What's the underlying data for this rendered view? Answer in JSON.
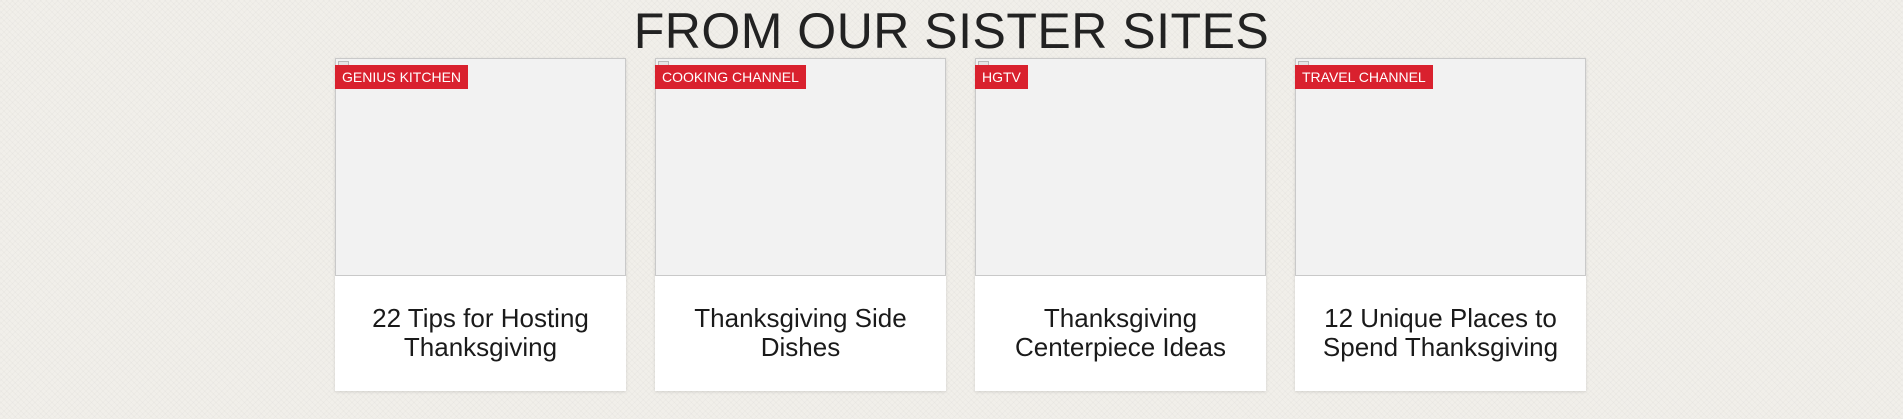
{
  "section": {
    "title": "FROM OUR SISTER SITES"
  },
  "cards": [
    {
      "source": "GENIUS KITCHEN",
      "title": "22 Tips for Hosting Thanksgiving"
    },
    {
      "source": "COOKING CHANNEL",
      "title": "Thanksgiving Side Dishes"
    },
    {
      "source": "HGTV",
      "title": "Thanksgiving Centerpiece Ideas"
    },
    {
      "source": "TRAVEL CHANNEL",
      "title": "12 Unique Places to Spend Thanksgiving"
    }
  ],
  "colors": {
    "tag_background": "#d9212e",
    "page_background": "#f1efea"
  }
}
